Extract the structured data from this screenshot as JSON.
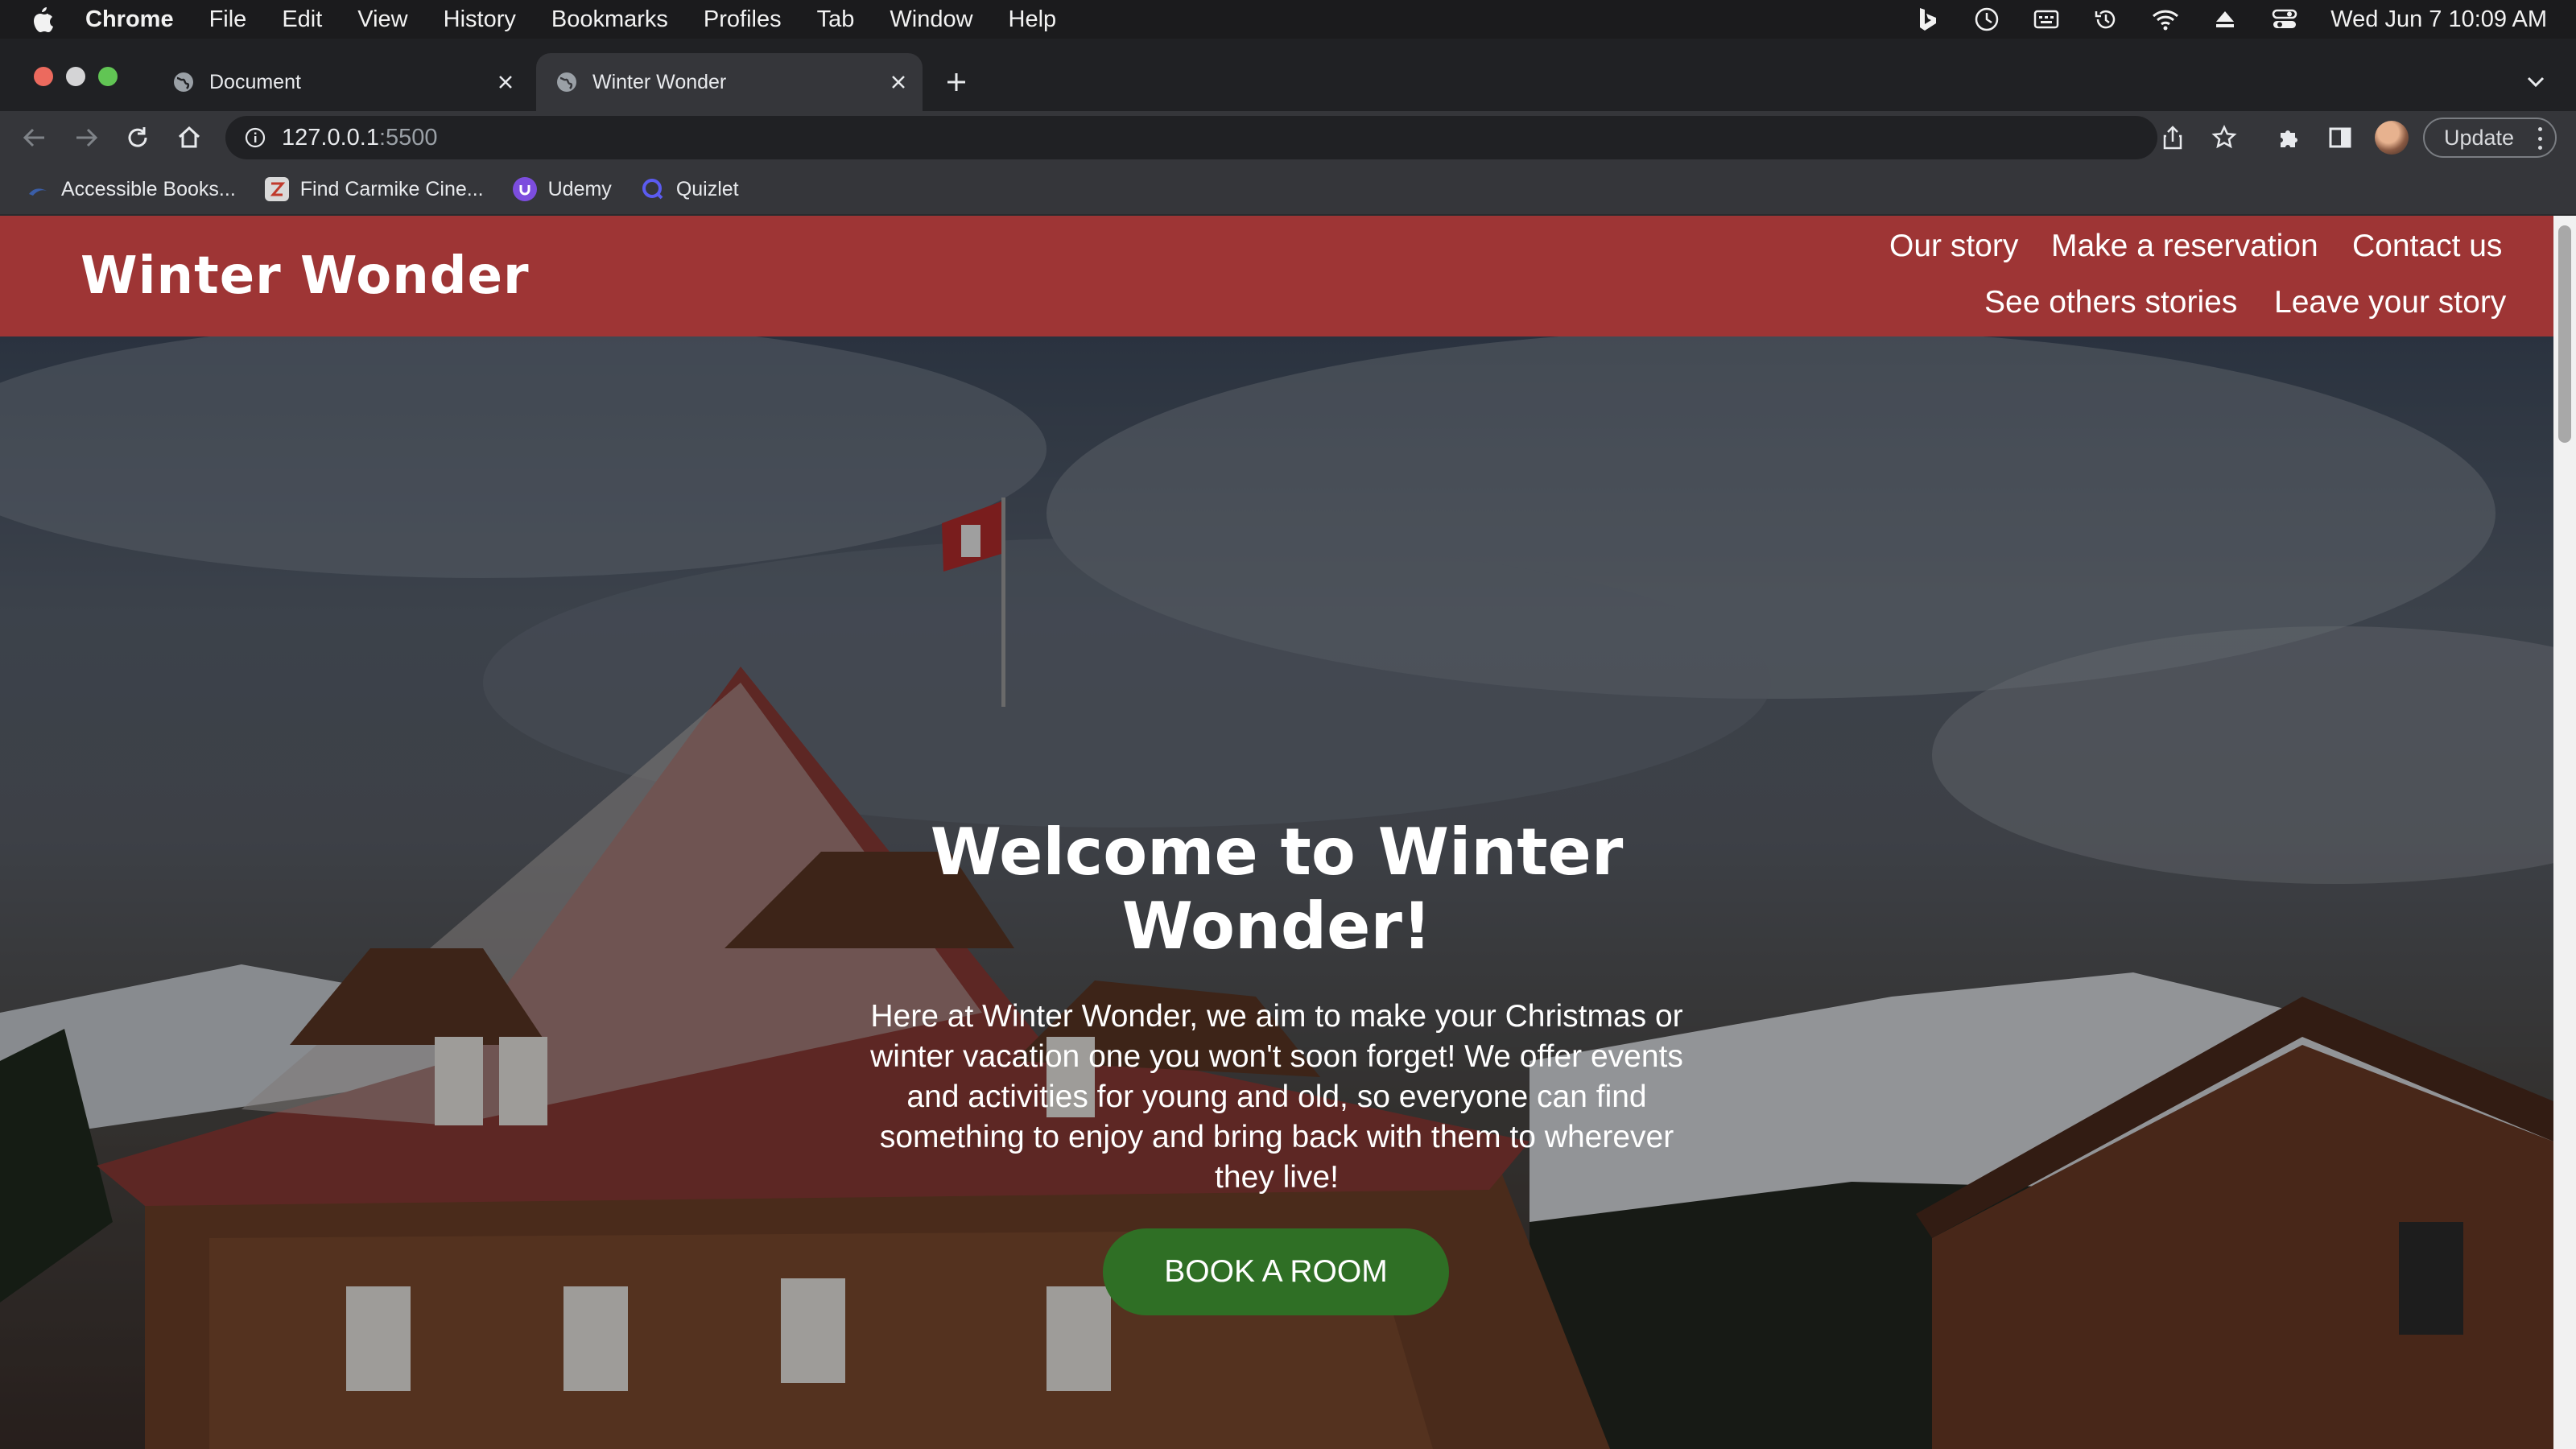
{
  "menubar": {
    "app": "Chrome",
    "items": [
      "File",
      "Edit",
      "View",
      "History",
      "Bookmarks",
      "Profiles",
      "Tab",
      "Window",
      "Help"
    ],
    "clock": "Wed Jun 7  10:09 AM",
    "status_icons": [
      "bing-icon",
      "clock-app-icon",
      "keyboard-icon",
      "time-machine-icon",
      "wifi-icon",
      "eject-icon",
      "control-center-icon"
    ]
  },
  "tabs": [
    {
      "title": "Document",
      "active": false
    },
    {
      "title": "Winter Wonder",
      "active": true
    }
  ],
  "omnibox": {
    "host": "127.0.0.1",
    "port": ":5500"
  },
  "toolbar": {
    "update_label": "Update"
  },
  "bookmarks": [
    {
      "label": "Accessible Books...",
      "icon": "bookshare-icon"
    },
    {
      "label": "Find Carmike Cine...",
      "icon": "carmike-icon"
    },
    {
      "label": "Udemy",
      "icon": "udemy-icon"
    },
    {
      "label": "Quizlet",
      "icon": "quizlet-icon"
    }
  ],
  "site": {
    "logo": "Winter Wonder",
    "nav": {
      "our_story": "Our story",
      "reservation": "Make a reservation",
      "contact": "Contact us",
      "others_stories": "See others stories",
      "leave_story": "Leave your story"
    },
    "hero": {
      "title": "Welcome to Winter Wonder!",
      "text": "Here at Winter Wonder, we aim to make your Christmas or winter vacation one you won't soon forget! We offer events and activities for young and old, so everyone can find something to enjoy and bring back with them to wherever they live!",
      "button": "BOOK A ROOM"
    },
    "colors": {
      "header": "#9e3535",
      "button": "#2f6f25"
    }
  }
}
